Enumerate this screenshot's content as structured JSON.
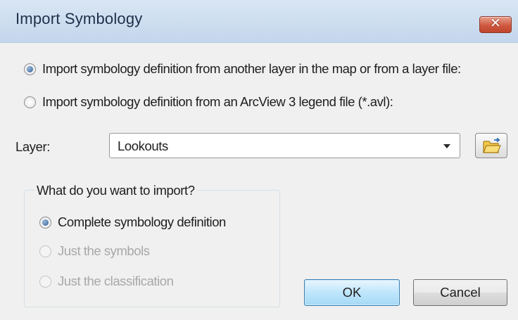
{
  "window": {
    "title": "Import Symbology",
    "close_label": "✕"
  },
  "source": {
    "options": [
      {
        "label": "Import symbology definition from another layer in the map or from a layer file:",
        "selected": true
      },
      {
        "label": "Import symbology definition from an ArcView 3 legend file (*.avl):",
        "selected": false
      }
    ]
  },
  "layer": {
    "label": "Layer:",
    "selected_value": "Lookouts",
    "browse_icon": "folder-open-icon"
  },
  "import_group": {
    "legend": "What do you want to import?",
    "options": [
      {
        "label": "Complete symbology definition",
        "selected": true,
        "enabled": true
      },
      {
        "label": "Just the symbols",
        "selected": false,
        "enabled": false
      },
      {
        "label": "Just the classification",
        "selected": false,
        "enabled": false
      }
    ]
  },
  "buttons": {
    "ok": "OK",
    "cancel": "Cancel"
  },
  "colors": {
    "titlebar": "#c9dbef",
    "close_button": "#cf5a40",
    "dialog_body": "#f0f0f0",
    "default_button": "#bee6fd",
    "disabled_text": "#a8a8a8"
  }
}
